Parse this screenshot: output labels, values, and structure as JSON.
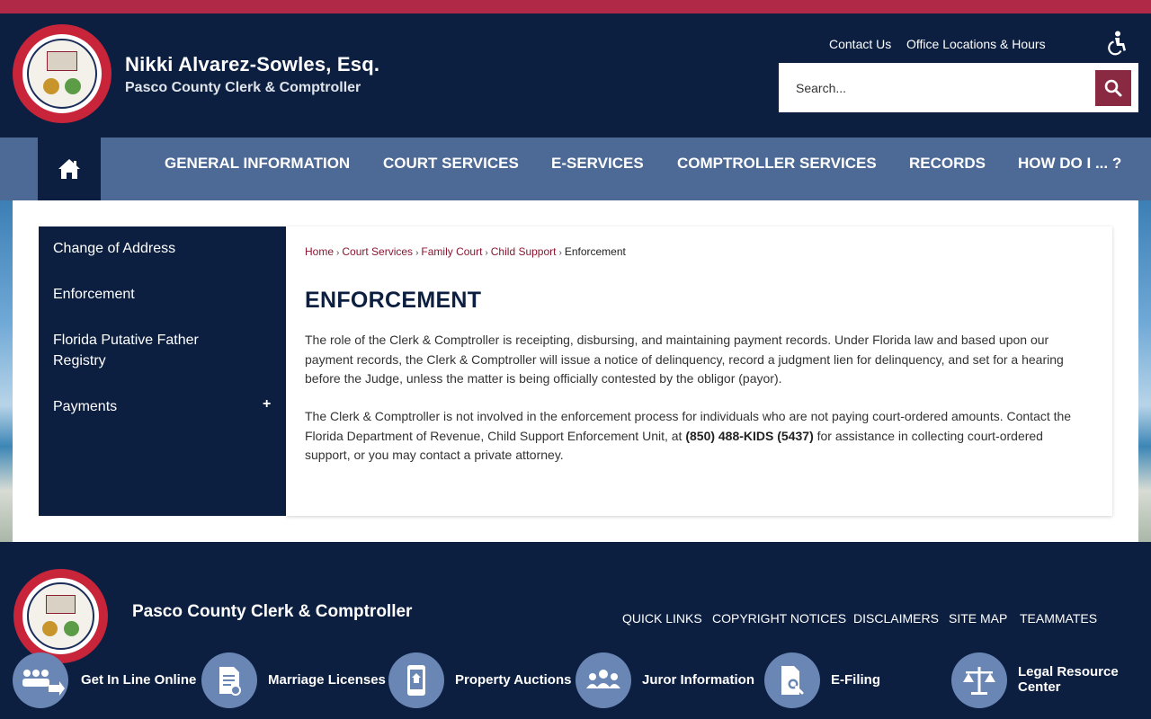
{
  "brand": {
    "name": "Nikki Alvarez-Sowles, Esq.",
    "subtitle": "Pasco County Clerk & Comptroller",
    "seal_icon": "county-seal-icon"
  },
  "utility": {
    "contact": "Contact Us",
    "locations": "Office Locations & Hours",
    "accessibility_icon": "accessibility-icon"
  },
  "search": {
    "placeholder": "Search...",
    "icon": "search-icon"
  },
  "nav": {
    "home_icon": "home-icon",
    "items": [
      "GENERAL INFORMATION",
      "COURT SERVICES",
      "E-SERVICES",
      "COMPTROLLER SERVICES",
      "RECORDS",
      "HOW DO I ... ?"
    ]
  },
  "sidebar": {
    "items": [
      "Change of Address",
      "Enforcement",
      "Florida Putative Father Registry",
      "Payments"
    ],
    "expand_symbol": "+"
  },
  "breadcrumb": {
    "items": [
      "Home",
      "Court Services",
      "Family Court",
      "Child Support"
    ],
    "separator": "›",
    "current": "Enforcement"
  },
  "page": {
    "title": "ENFORCEMENT",
    "para1": "The role of the Clerk & Comptroller is receipting, disbursing, and maintaining payment records. Under Florida law and based upon our payment records, the Clerk & Comptroller will issue a notice of delinquency, record a judgment lien for delinquency, and set for a hearing before the Judge, unless the matter is being officially contested by the obligor (payor).",
    "para2_before": "The Clerk & Comptroller is not involved in the enforcement process for individuals who are not paying court-ordered amounts. Contact the Florida Department of Revenue, Child Support Enforcement Unit, at ",
    "para2_phone": "(850) 488-KIDS (5437)",
    "para2_after": " for assistance in collecting court-ordered support, or you may contact a private attorney."
  },
  "footer": {
    "name": "Pasco County Clerk & Comptroller",
    "links": [
      "QUICK LINKS",
      "COPYRIGHT NOTICES",
      "DISCLAIMERS",
      "SITE MAP",
      "TEAMMATES"
    ]
  },
  "quick_links": [
    {
      "label": "Get In Line Online",
      "icon": "queue-icon"
    },
    {
      "label": "Marriage Licenses",
      "icon": "certificate-icon"
    },
    {
      "label": "Property Auctions",
      "icon": "house-phone-icon"
    },
    {
      "label": "Juror Information",
      "icon": "group-icon"
    },
    {
      "label": "E-Filing",
      "icon": "document-search-icon"
    },
    {
      "label": "Legal Resource Center",
      "icon": "scales-icon"
    }
  ],
  "colors": {
    "navy": "#0c1f40",
    "nav_blue": "#4d6995",
    "accent_red": "#b02a48",
    "link_maroon": "#8a1630",
    "search_button": "#8a2a42"
  }
}
